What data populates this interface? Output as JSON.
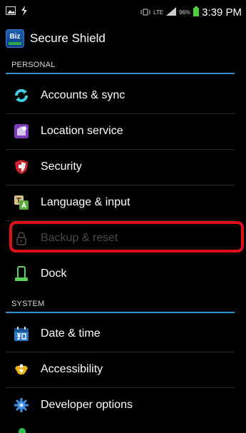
{
  "status_bar": {
    "network_label": "LTE",
    "battery_label": "96%",
    "time": "3:39 PM"
  },
  "app": {
    "icon_text": "Biz",
    "title": "Secure Shield"
  },
  "sections": {
    "personal": "PERSONAL",
    "system": "SYSTEM"
  },
  "items": [
    {
      "label": "Accounts & sync",
      "icon": "sync-icon"
    },
    {
      "label": "Location service",
      "icon": "location-icon"
    },
    {
      "label": "Security",
      "icon": "shield-icon"
    },
    {
      "label": "Language & input",
      "icon": "language-icon"
    },
    {
      "label": "Backup & reset",
      "icon": "lock-icon",
      "disabled": true
    },
    {
      "label": "Dock",
      "icon": "dock-icon"
    },
    {
      "label": "Date & time",
      "icon": "calendar-icon"
    },
    {
      "label": "Accessibility",
      "icon": "accessibility-icon"
    },
    {
      "label": "Developer options",
      "icon": "gear-icon"
    }
  ],
  "colors": {
    "accent": "#2f8fd0",
    "highlight": "#e0101a",
    "battery": "#4cd137"
  }
}
